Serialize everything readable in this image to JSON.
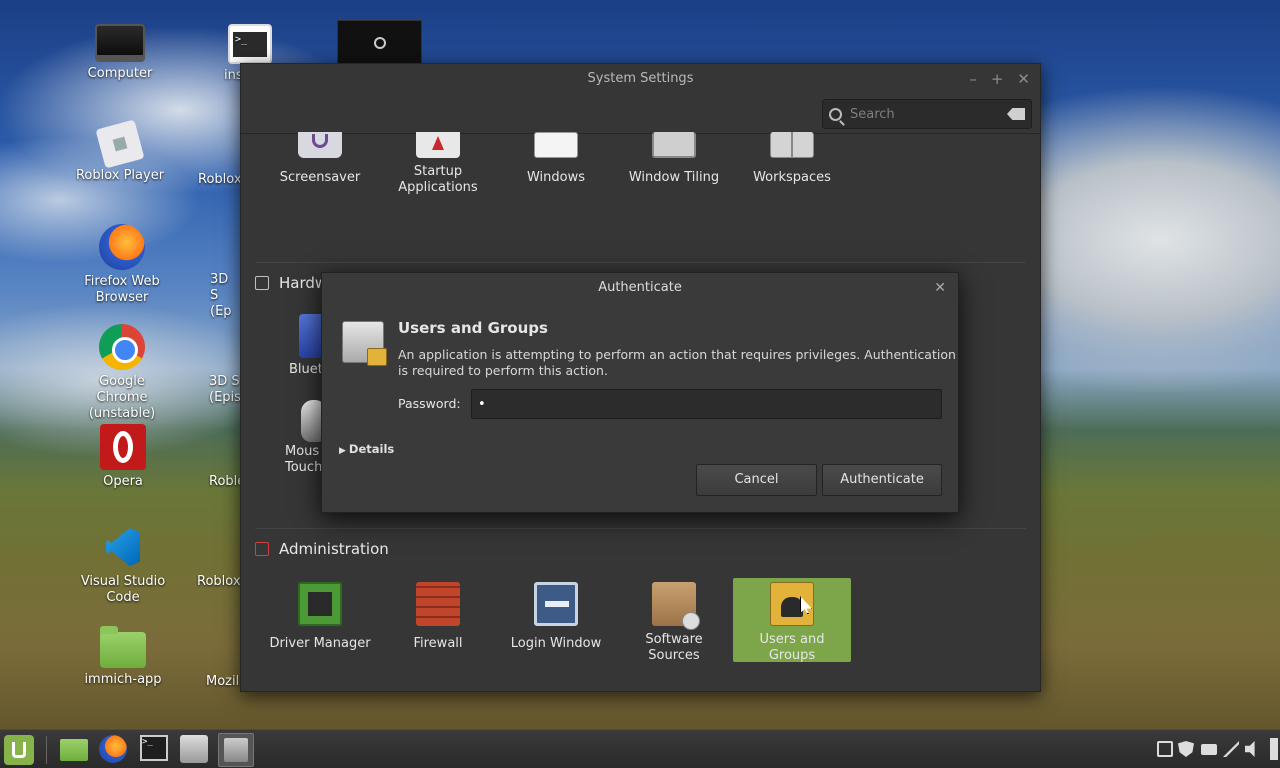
{
  "desktop": {
    "icons_col1": [
      {
        "label": "Computer",
        "icon": "computer-icon"
      },
      {
        "label": "Roblox Player",
        "icon": "roblox-icon"
      },
      {
        "label": "Firefox Web Browser",
        "icon": "firefox-icon"
      },
      {
        "label": "Google Chrome (unstable)",
        "icon": "chrome-icon"
      },
      {
        "label": "Opera",
        "icon": "opera-icon"
      },
      {
        "label": "Visual Studio Code",
        "icon": "vscode-icon"
      },
      {
        "label": "immich-app",
        "icon": "folder-icon"
      }
    ],
    "icons_col2_partial": [
      {
        "label": "ins",
        "icon": "terminal-icon"
      },
      {
        "label": "Roblox"
      },
      {
        "label": "3D S (Ep"
      },
      {
        "label": "3D S (Epis"
      },
      {
        "label": "Roble"
      },
      {
        "label": "Roblox"
      },
      {
        "label": "Mozil"
      }
    ]
  },
  "settings_window": {
    "title": "System Settings",
    "search_placeholder": "Search",
    "top_row": [
      {
        "label": "Screensaver",
        "icon": "screensaver-icon"
      },
      {
        "label": "Startup Applications",
        "icon": "startup-icon"
      },
      {
        "label": "Windows",
        "icon": "windows-icon"
      },
      {
        "label": "Window Tiling",
        "icon": "window-tiling-icon"
      },
      {
        "label": "Workspaces",
        "icon": "workspaces-icon"
      }
    ],
    "hardware_section": {
      "title_visible": "Hardw",
      "items_visible": [
        "Bluet",
        "Mous Touch"
      ]
    },
    "administration_section": {
      "title": "Administration",
      "items": [
        {
          "label": "Driver Manager",
          "icon": "driver-manager-icon"
        },
        {
          "label": "Firewall",
          "icon": "firewall-icon"
        },
        {
          "label": "Login Window",
          "icon": "login-window-icon"
        },
        {
          "label": "Software Sources",
          "icon": "software-sources-icon"
        },
        {
          "label": "Users and Groups",
          "icon": "users-groups-icon",
          "selected": true
        }
      ]
    }
  },
  "auth_dialog": {
    "title": "Authenticate",
    "heading": "Users and Groups",
    "message": "An application is attempting to perform an action that requires privileges. Authentication is required to perform this action.",
    "password_label": "Password:",
    "password_value": "•",
    "details_label": "Details",
    "cancel_label": "Cancel",
    "authenticate_label": "Authenticate"
  },
  "colors": {
    "selected_tile": "#7da64b",
    "window_bg": "#363636",
    "dialog_bg": "#3a3a3a"
  }
}
